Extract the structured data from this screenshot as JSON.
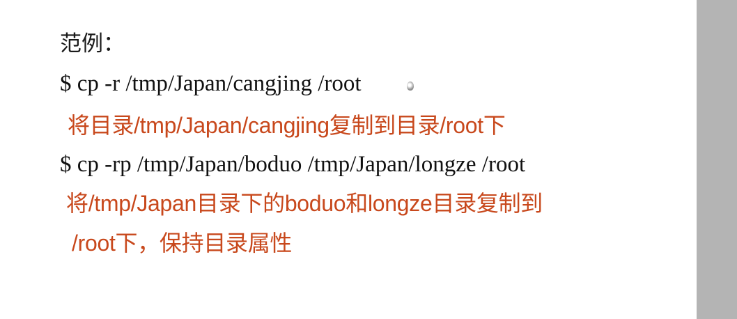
{
  "slide": {
    "heading": "范例：",
    "examples": [
      {
        "command": "$ cp  -r /tmp/Japan/cangjing  /root",
        "note": "将目录/tmp/Japan/cangjing复制到目录/root下"
      },
      {
        "command": "$ cp  -rp /tmp/Japan/boduo /tmp/Japan/longze /root",
        "note_line1": "将/tmp/Japan目录下的boduo和longze目录复制到",
        "note_line2": "/root下，保持目录属性"
      }
    ]
  },
  "colors": {
    "command_text": "#111111",
    "note_text": "#c8481c",
    "sidebar": "#b4b4b4"
  },
  "icons": {
    "cursor": "mouse-pointer-icon"
  }
}
